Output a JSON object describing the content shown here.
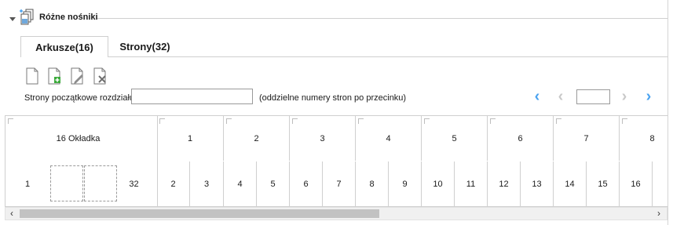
{
  "section": {
    "title": "Różne nośniki"
  },
  "tabs": [
    {
      "label": "Arkusze(16)",
      "active": true
    },
    {
      "label": "Strony(32)",
      "active": false
    }
  ],
  "toolbar": {
    "icons": [
      "new-sheet-icon",
      "add-sheet-icon",
      "edit-sheet-icon",
      "delete-sheet-icon"
    ]
  },
  "chapter": {
    "label": "Strony początkowe rozdziału:",
    "value": "",
    "hint": "(oddzielne numery stron po przecinku)"
  },
  "pager": {
    "value": ""
  },
  "sheets": [
    "16 Okładka",
    "1",
    "2",
    "3",
    "4",
    "5",
    "6",
    "7",
    "8"
  ],
  "pages": {
    "cover": [
      "1",
      "",
      "",
      "32"
    ],
    "body": [
      "2",
      "3",
      "4",
      "5",
      "6",
      "7",
      "8",
      "9",
      "10",
      "11",
      "12",
      "13",
      "14",
      "15",
      "16"
    ]
  }
}
